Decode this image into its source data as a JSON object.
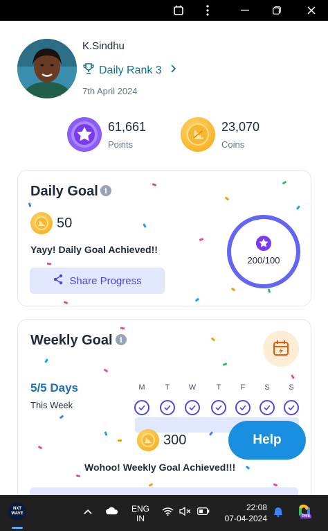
{
  "window": {
    "controls": [
      "restore-icon",
      "more-icon",
      "minimize-icon",
      "maximize-icon",
      "close-icon"
    ]
  },
  "profile": {
    "name": "K.Sindhu",
    "rank_label": "Daily Rank 3",
    "date": "7th April 2024"
  },
  "stats": {
    "points": {
      "value": "61,661",
      "label": "Points"
    },
    "coins": {
      "value": "23,070",
      "label": "Coins"
    }
  },
  "daily_goal": {
    "title": "Daily Goal",
    "info_icon": "i",
    "coins": "50",
    "message": "Yayy! Daily Goal Achieved!!",
    "share_label": "Share Progress",
    "progress_text": "200/100",
    "progress_fraction": 1.0
  },
  "weekly_goal": {
    "title": "Weekly Goal",
    "info_icon": "i",
    "days_label": "5/5 Days",
    "period_label": "This Week",
    "days": [
      "M",
      "T",
      "W",
      "T",
      "F",
      "S",
      "S"
    ],
    "coins": "300",
    "message": "Wohoo! Weekly Goal Achieved!!!"
  },
  "help": {
    "label": "Help"
  },
  "taskbar": {
    "app_badge": "NXT WAVE",
    "lang_top": "ENG",
    "lang_bottom": "IN",
    "time": "22:08",
    "date": "07-04-2024",
    "copilot_badge": "PRE"
  },
  "colors": {
    "accent": "#4f46e5",
    "teal": "#0e7490",
    "help": "#1b8fdf",
    "coin": "#f5a70f",
    "purple": "#7c3aed"
  }
}
